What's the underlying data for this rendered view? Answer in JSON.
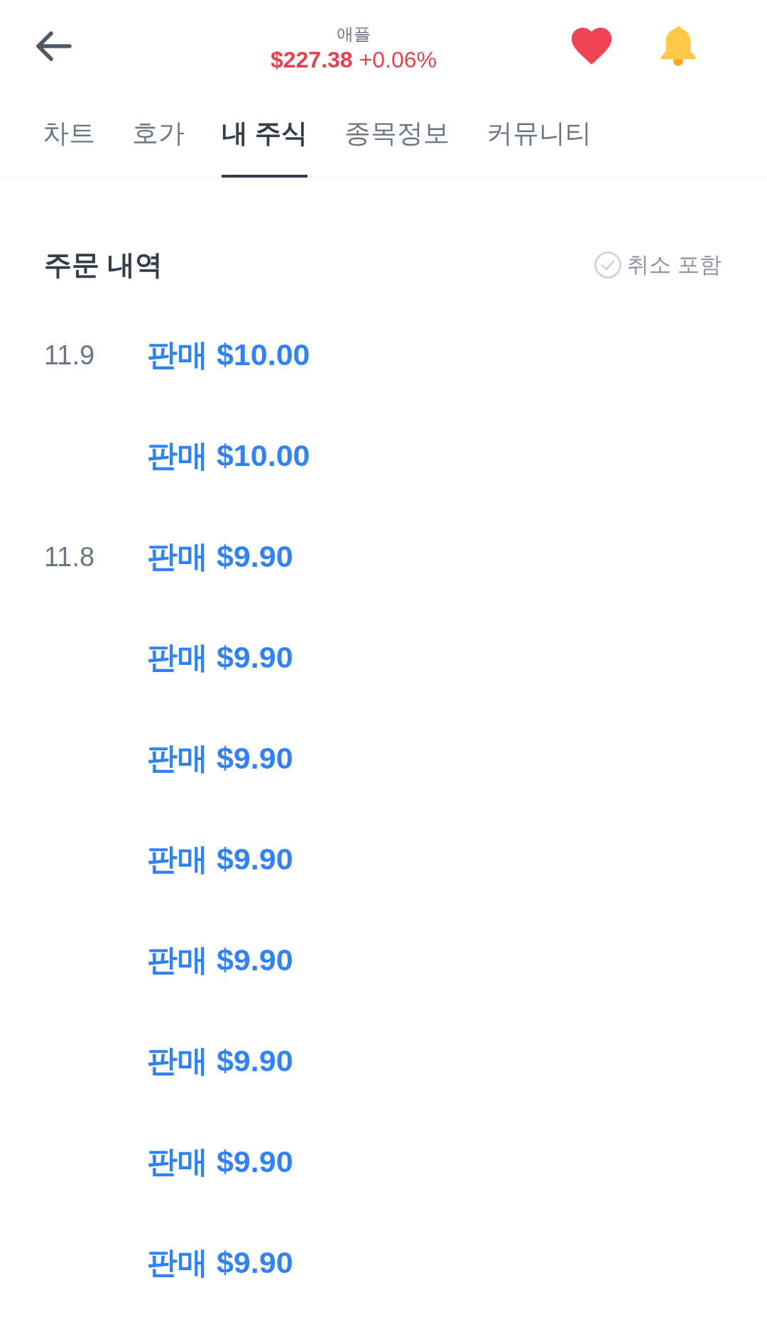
{
  "header": {
    "title": "애플",
    "price": "$227.38",
    "change": "+0.06%",
    "favorited": true
  },
  "tabs": [
    {
      "label": "차트",
      "selected": false
    },
    {
      "label": "호가",
      "selected": false
    },
    {
      "label": "내 주식",
      "selected": true
    },
    {
      "label": "종목정보",
      "selected": false
    },
    {
      "label": "커뮤니티",
      "selected": false
    }
  ],
  "orders_section": {
    "title": "주문 내역",
    "filter": {
      "label": "취소 포함",
      "checked": false
    }
  },
  "orders": [
    {
      "date": "11.9",
      "summary": "판매 $10.00"
    },
    {
      "summary": "판매 $10.00"
    },
    {
      "date": "11.8",
      "summary": "판매 $9.90"
    },
    {
      "summary": "판매 $9.90"
    },
    {
      "summary": "판매 $9.90"
    },
    {
      "summary": "판매 $9.90"
    },
    {
      "summary": "판매 $9.90"
    },
    {
      "summary": "판매 $9.90"
    },
    {
      "summary": "판매 $9.90"
    },
    {
      "summary": "판매 $9.90"
    }
  ]
}
